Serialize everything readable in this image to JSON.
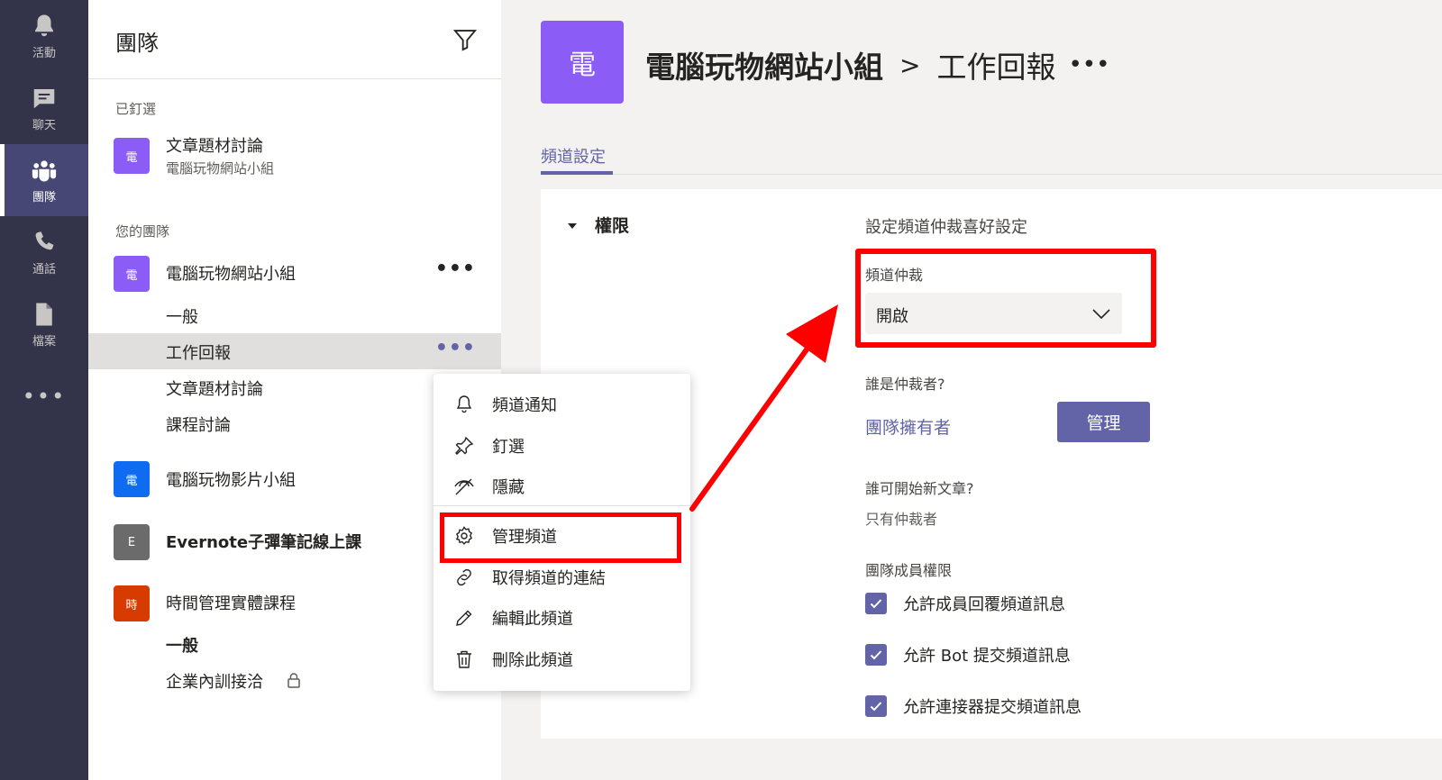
{
  "rail": {
    "items": [
      {
        "label": "活動",
        "icon": "bell-icon"
      },
      {
        "label": "聊天",
        "icon": "chat-icon"
      },
      {
        "label": "團隊",
        "icon": "teams-icon"
      },
      {
        "label": "通話",
        "icon": "phone-icon"
      },
      {
        "label": "檔案",
        "icon": "file-icon"
      }
    ],
    "more": "•••"
  },
  "panel": {
    "title": "團隊",
    "pinned_label": "已釘選",
    "pinned": {
      "avatar": "電",
      "name": "文章題材討論",
      "team": "電腦玩物網站小組"
    },
    "your_teams_label": "您的團隊",
    "teams": [
      {
        "avatar": "電",
        "name": "電腦玩物網站小組",
        "more": "•••",
        "color": "#8b5cf6",
        "channels": [
          {
            "label": "一般"
          },
          {
            "label": "工作回報",
            "more": "•••"
          },
          {
            "label": "文章題材討論"
          },
          {
            "label": "課程討論"
          }
        ]
      },
      {
        "avatar": "電",
        "name": "電腦玩物影片小組",
        "color": "#0f6cf0"
      },
      {
        "avatar": "E",
        "name": "Evernote子彈筆記線上課",
        "color": "#6b6b6b"
      },
      {
        "avatar": "時",
        "name": "時間管理實體課程",
        "color": "#d83b01",
        "channels": [
          {
            "label": "一般"
          },
          {
            "label": "企業內訓接洽"
          }
        ]
      }
    ]
  },
  "context_menu": {
    "items": [
      {
        "label": "頻道通知",
        "icon": "bell-icon"
      },
      {
        "label": "釘選",
        "icon": "pin-icon"
      },
      {
        "label": "隱藏",
        "icon": "hide-icon"
      },
      {
        "label": "管理頻道",
        "icon": "gear-icon"
      },
      {
        "label": "取得頻道的連結",
        "icon": "link-icon"
      },
      {
        "label": "編輯此頻道",
        "icon": "pencil-icon"
      },
      {
        "label": "刪除此頻道",
        "icon": "trash-icon"
      }
    ]
  },
  "main": {
    "avatar": "電",
    "team_name": "電腦玩物網站小組",
    "separator": ">",
    "channel_name": "工作回報",
    "more": "•••",
    "tab": "頻道設定",
    "section_title": "權限",
    "settings_title": "設定頻道仲裁喜好設定",
    "moderation_label": "頻道仲裁",
    "moderation_value": "開啟",
    "moderators_label": "誰是仲裁者?",
    "moderators_value": "團隊擁有者",
    "manage_button": "管理",
    "new_post_label": "誰可開始新文章?",
    "new_post_value": "只有仲裁者",
    "member_perm_label": "團隊成員權限",
    "checkboxes": [
      {
        "label": "允許成員回覆頻道訊息",
        "checked": true
      },
      {
        "label": "允許 Bot 提交頻道訊息",
        "checked": true
      },
      {
        "label": "允許連接器提交頻道訊息",
        "checked": true
      }
    ]
  },
  "colors": {
    "rail_bg": "#33344a",
    "accent": "#6264a7",
    "highlight": "#ff0000"
  }
}
